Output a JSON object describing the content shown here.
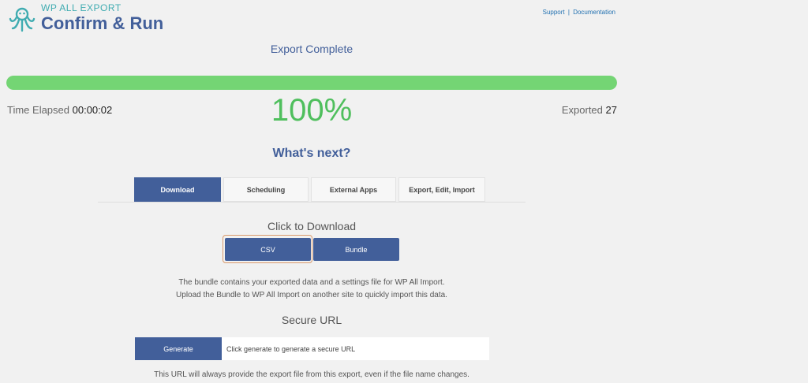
{
  "brand": {
    "top": "WP ALL EXPORT",
    "title": "Confirm & Run"
  },
  "links": {
    "support": "Support",
    "separator": "|",
    "documentation": "Documentation"
  },
  "status": {
    "title": "Export Complete",
    "progress_fraction": 1.0,
    "percent_label": "100%",
    "elapsed_label": "Time Elapsed",
    "elapsed_value": "00:00:02",
    "exported_label": "Exported",
    "exported_value": "27"
  },
  "whats_next": "What's next?",
  "tabs": [
    {
      "label": "Download",
      "active": true
    },
    {
      "label": "Scheduling",
      "active": false
    },
    {
      "label": "External Apps",
      "active": false
    },
    {
      "label": "Export, Edit, Import",
      "active": false
    }
  ],
  "download": {
    "title": "Click to Download",
    "csv_label": "CSV",
    "bundle_label": "Bundle",
    "note_line1": "The bundle contains your exported data and a settings file for WP All Import.",
    "note_line2": "Upload the Bundle to WP All Import on another site to quickly import this data."
  },
  "secure_url": {
    "title": "Secure URL",
    "generate_label": "Generate",
    "input_value": "Click generate to generate a secure URL",
    "note": "This URL will always provide the export file from this export, even if the file name changes."
  },
  "colors": {
    "accent": "#425f9a",
    "progress": "#74d574",
    "percent": "#4fbf5d",
    "brand_teal": "#40acb1",
    "link": "#2271b1"
  }
}
